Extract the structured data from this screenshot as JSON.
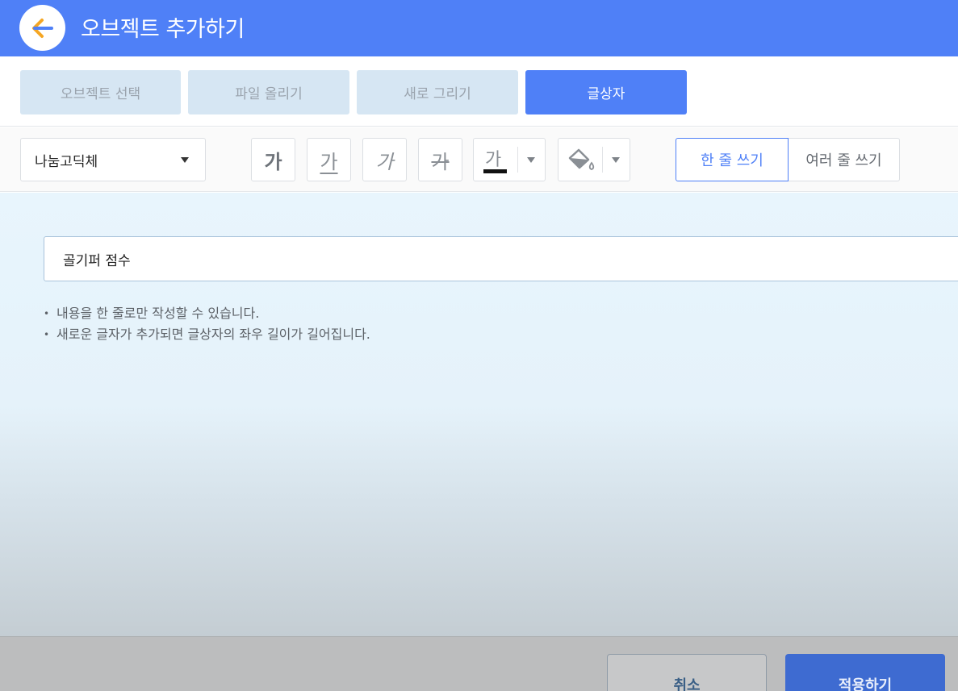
{
  "header": {
    "title": "오브젝트 추가하기",
    "back_icon": "arrow-left-icon",
    "back_icon_color": "#f5a623"
  },
  "tabs": [
    {
      "label": "오브젝트 선택",
      "active": false
    },
    {
      "label": "파일 올리기",
      "active": false
    },
    {
      "label": "새로 그리기",
      "active": false
    },
    {
      "label": "글상자",
      "active": true
    }
  ],
  "toolbar": {
    "font_value": "나눔고딕체",
    "bold_glyph": "가",
    "underline_glyph": "가",
    "italic_glyph": "가",
    "strike_glyph": "가",
    "text_color_glyph": "가",
    "text_color": "#000000",
    "fill_icon": "paint-bucket-icon",
    "single_line_label": "한 줄 쓰기",
    "multi_line_label": "여러 줄 쓰기",
    "active_mode": "single_line"
  },
  "editor": {
    "text_value": "골기퍼 점수",
    "hints": [
      "내용을 한 줄로만 작성할 수 있습니다.",
      "새로운 글자가 추가되면 글상자의 좌우 길이가 길어집니다."
    ]
  },
  "footer": {
    "cancel_label": "취소",
    "apply_label": "적용하기"
  },
  "colors": {
    "accent": "#4f80f7",
    "tab_inactive_bg": "#d6e6f3",
    "apply_button": "#3e6bd1"
  }
}
